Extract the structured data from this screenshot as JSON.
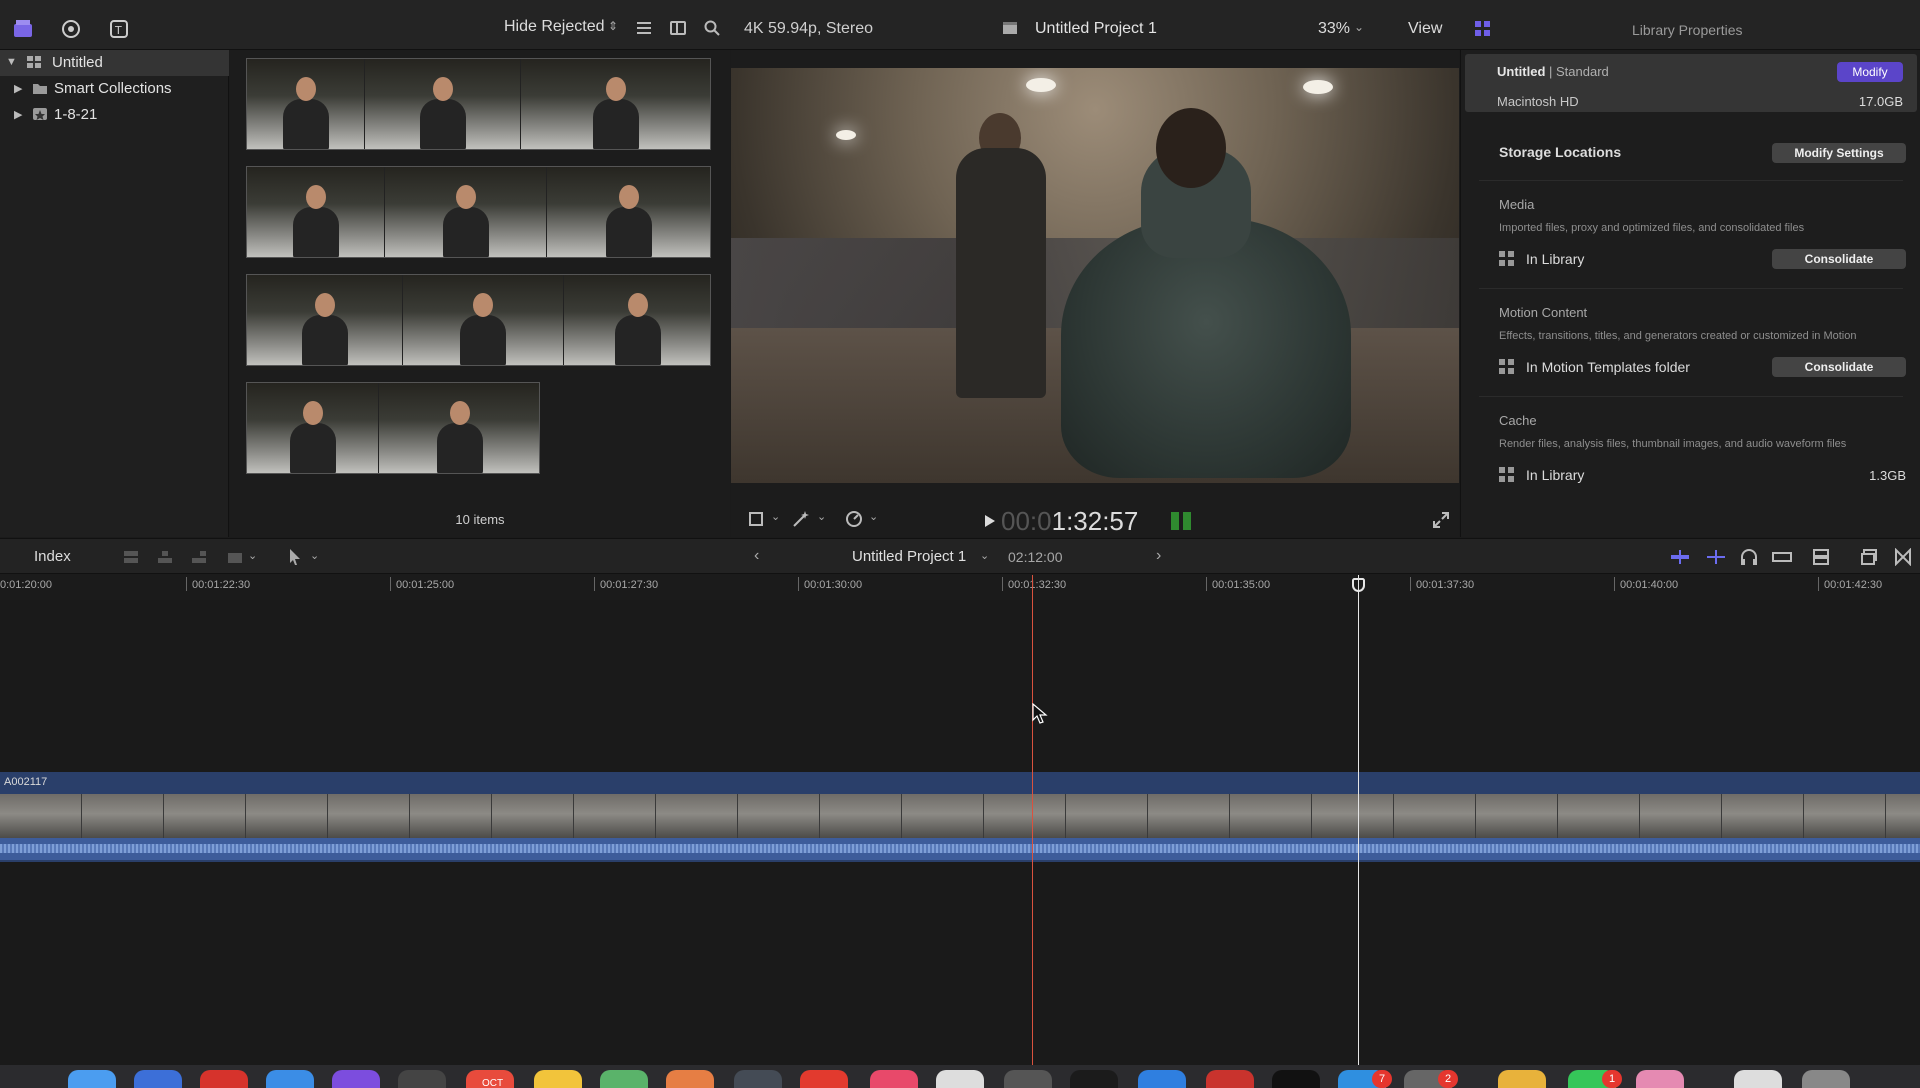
{
  "toolbar": {
    "filter_label": "Hide Rejected",
    "format_label": "4K 59.94p, Stereo",
    "project_title": "Untitled Project 1",
    "zoom_label": "33%",
    "view_label": "View",
    "inspector_title": "Library Properties"
  },
  "sidebar": {
    "items": [
      {
        "label": "Untitled",
        "icon": "library-icon"
      },
      {
        "label": "Smart Collections",
        "icon": "folder-icon"
      },
      {
        "label": "1-8-21",
        "icon": "event-icon"
      }
    ]
  },
  "browser": {
    "items_count": "10 items"
  },
  "viewer": {
    "timecode_dim": "00:0",
    "timecode": "1:32:57"
  },
  "inspector": {
    "library_name": "Untitled",
    "library_type": "| Standard",
    "modify_label": "Modify",
    "drive_name": "Macintosh HD",
    "drive_size": "17.0GB",
    "storage_title": "Storage Locations",
    "modify_settings_label": "Modify Settings",
    "media": {
      "title": "Media",
      "desc": "Imported files, proxy and optimized files, and consolidated files",
      "location": "In Library",
      "button": "Consolidate"
    },
    "motion": {
      "title": "Motion Content",
      "desc": "Effects, transitions, titles, and generators created or customized in Motion",
      "location": "In Motion Templates folder",
      "button": "Consolidate"
    },
    "cache": {
      "title": "Cache",
      "desc": "Render files, analysis files, thumbnail images, and audio waveform files",
      "location": "In Library",
      "size": "1.3GB"
    }
  },
  "timeline": {
    "index_label": "Index",
    "project_label": "Untitled Project 1",
    "duration": "02:12:00",
    "ruler": [
      "0:01:20:00",
      "00:01:22:30",
      "00:01:25:00",
      "00:01:27:30",
      "00:01:30:00",
      "00:01:32:30",
      "00:01:35:00",
      "00:01:37:30",
      "00:01:40:00",
      "00:01:42:30"
    ],
    "clip_name": "A002117"
  },
  "dock": {
    "calendar_label": "OCT",
    "badges": [
      "7",
      "2",
      "1"
    ]
  },
  "colors": {
    "accent": "#5b45c9",
    "clip_blue": "#2a3f6a",
    "skimmer": "#d9523e"
  }
}
